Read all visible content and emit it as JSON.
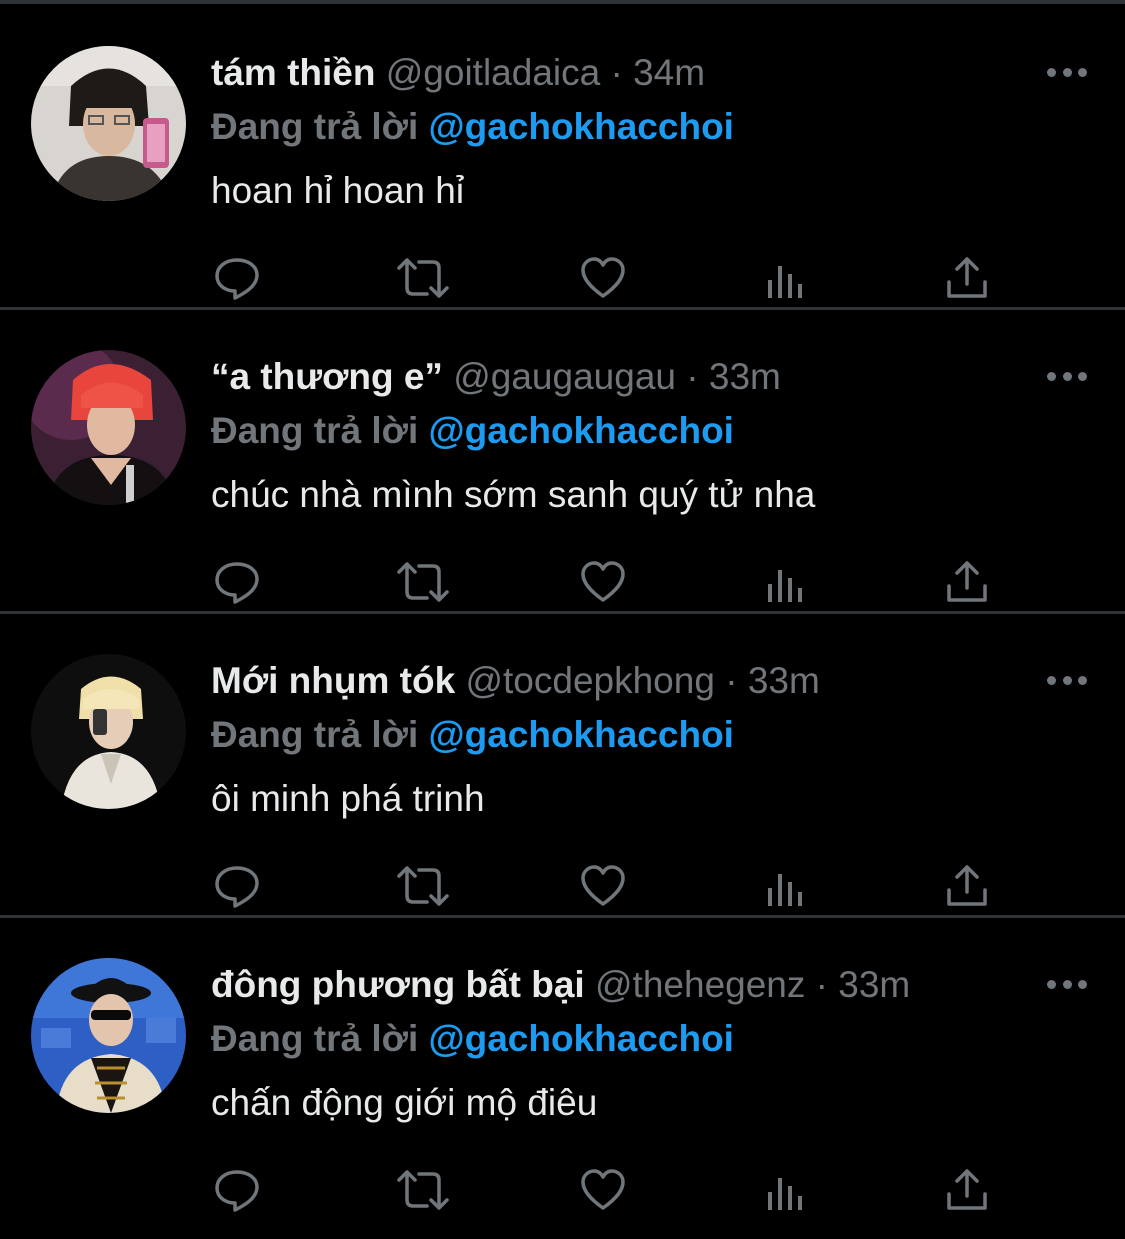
{
  "tweets": [
    {
      "name": "tám thiền",
      "handle": "@goitladaica",
      "separator": "·",
      "time": "34m",
      "reply_prefix": "Đang trả lời",
      "reply_target": "@gachokhacchoi",
      "text": "hoan hỉ hoan hỉ",
      "avatar_colors": [
        "#d8d4cf",
        "#2a2522",
        "#b8b0a6"
      ]
    },
    {
      "name": "“a thương e”",
      "handle": "@gaugaugau",
      "separator": "·",
      "time": "33m",
      "reply_prefix": "Đang trả lời",
      "reply_target": "@gachokhacchoi",
      "text": "chúc nhà mình sớm sanh quý tử nha",
      "avatar_colors": [
        "#5a2a4a",
        "#e8453c",
        "#1a1416"
      ]
    },
    {
      "name": "Mới nhụm tók",
      "handle": "@tocdepkhong",
      "separator": "·",
      "time": "33m",
      "reply_prefix": "Đang trả lời",
      "reply_target": "@gachokhacchoi",
      "text": "ôi minh phá trinh",
      "avatar_colors": [
        "#0e0e0e",
        "#e9e5dc",
        "#f0dfa8"
      ]
    },
    {
      "name": "đông phương bất bại",
      "handle": "@thehegenz",
      "separator": "·",
      "time": "33m",
      "reply_prefix": "Đang trả lời",
      "reply_target": "@gachokhacchoi",
      "text": "chấn động giới mộ điêu",
      "avatar_colors": [
        "#2d5fc4",
        "#111111",
        "#e8ddc8"
      ]
    }
  ],
  "icons": {
    "more": "more-horizontal-icon",
    "reply": "reply-bubble-icon",
    "retweet": "retweet-arrows-icon",
    "like": "heart-outline-icon",
    "views": "views-bar-chart-icon",
    "share": "share-upload-icon"
  },
  "colors": {
    "background": "#000000",
    "primary_text": "#e7e9ea",
    "secondary_text": "#71767b",
    "link": "#1d9bf0",
    "divider": "#2f3336"
  }
}
